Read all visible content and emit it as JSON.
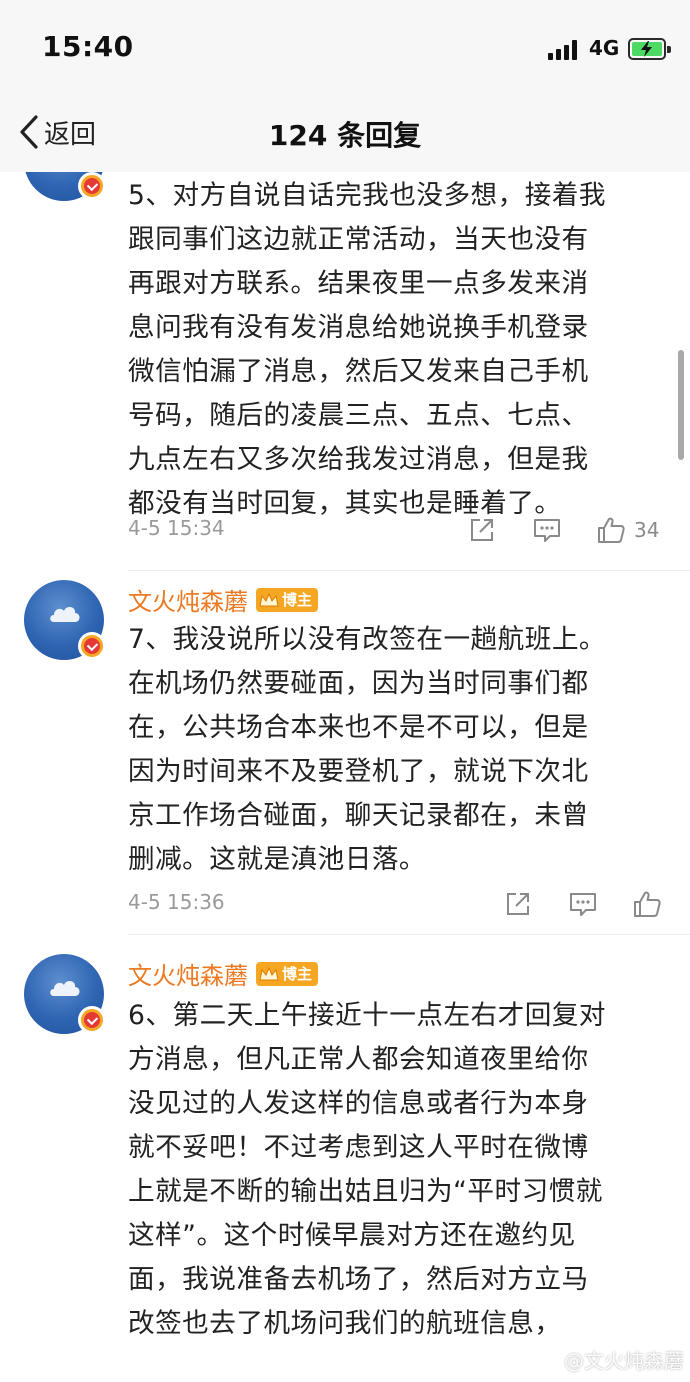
{
  "status_bar": {
    "time": "15:40",
    "network": "4G"
  },
  "nav": {
    "back_label": "返回",
    "title": "124 条回复"
  },
  "comments": [
    {
      "text_lines": [
        "5、对方自说自话完我也没多想，接着我",
        "跟同事们这边就正常活动，当天也没有",
        "再跟对方联系。结果夜里一点多发来消",
        "息问我有没有发消息给她说换手机登录",
        "微信怕漏了消息，然后又发来自己手机",
        "号码，随后的凌晨三点、五点、七点、",
        "九点左右又多次给我发过消息，但是我",
        "都没有当时回复，其实也是睡着了。"
      ],
      "timestamp": "4-5 15:34",
      "like_count": "34"
    },
    {
      "username": "文火炖森蘑",
      "badge": "博主",
      "text_lines": [
        "7、我没说所以没有改签在一趟航班上。",
        "在机场仍然要碰面，因为当时同事们都",
        "在，公共场合本来也不是不可以，但是",
        "因为时间来不及要登机了，就说下次北",
        "京工作场合碰面，聊天记录都在，未曾",
        "删减。这就是滇池日落。"
      ],
      "timestamp": "4-5 15:36"
    },
    {
      "username": "文火炖森蘑",
      "badge": "博主",
      "text_lines": [
        "6、第二天上午接近十一点左右才回复对",
        "方消息，但凡正常人都会知道夜里给你",
        "没见过的人发这样的信息或者行为本身",
        "就不妥吧！不过考虑到这人平时在微博",
        "上就是不断的输出姑且归为“平时习惯就",
        "这样”。这个时候早晨对方还在邀约见",
        "面，我说准备去机场了，然后对方立马",
        "改签也去了机场问我们的航班信息，"
      ]
    }
  ],
  "watermark": "@文火炖森蘑"
}
